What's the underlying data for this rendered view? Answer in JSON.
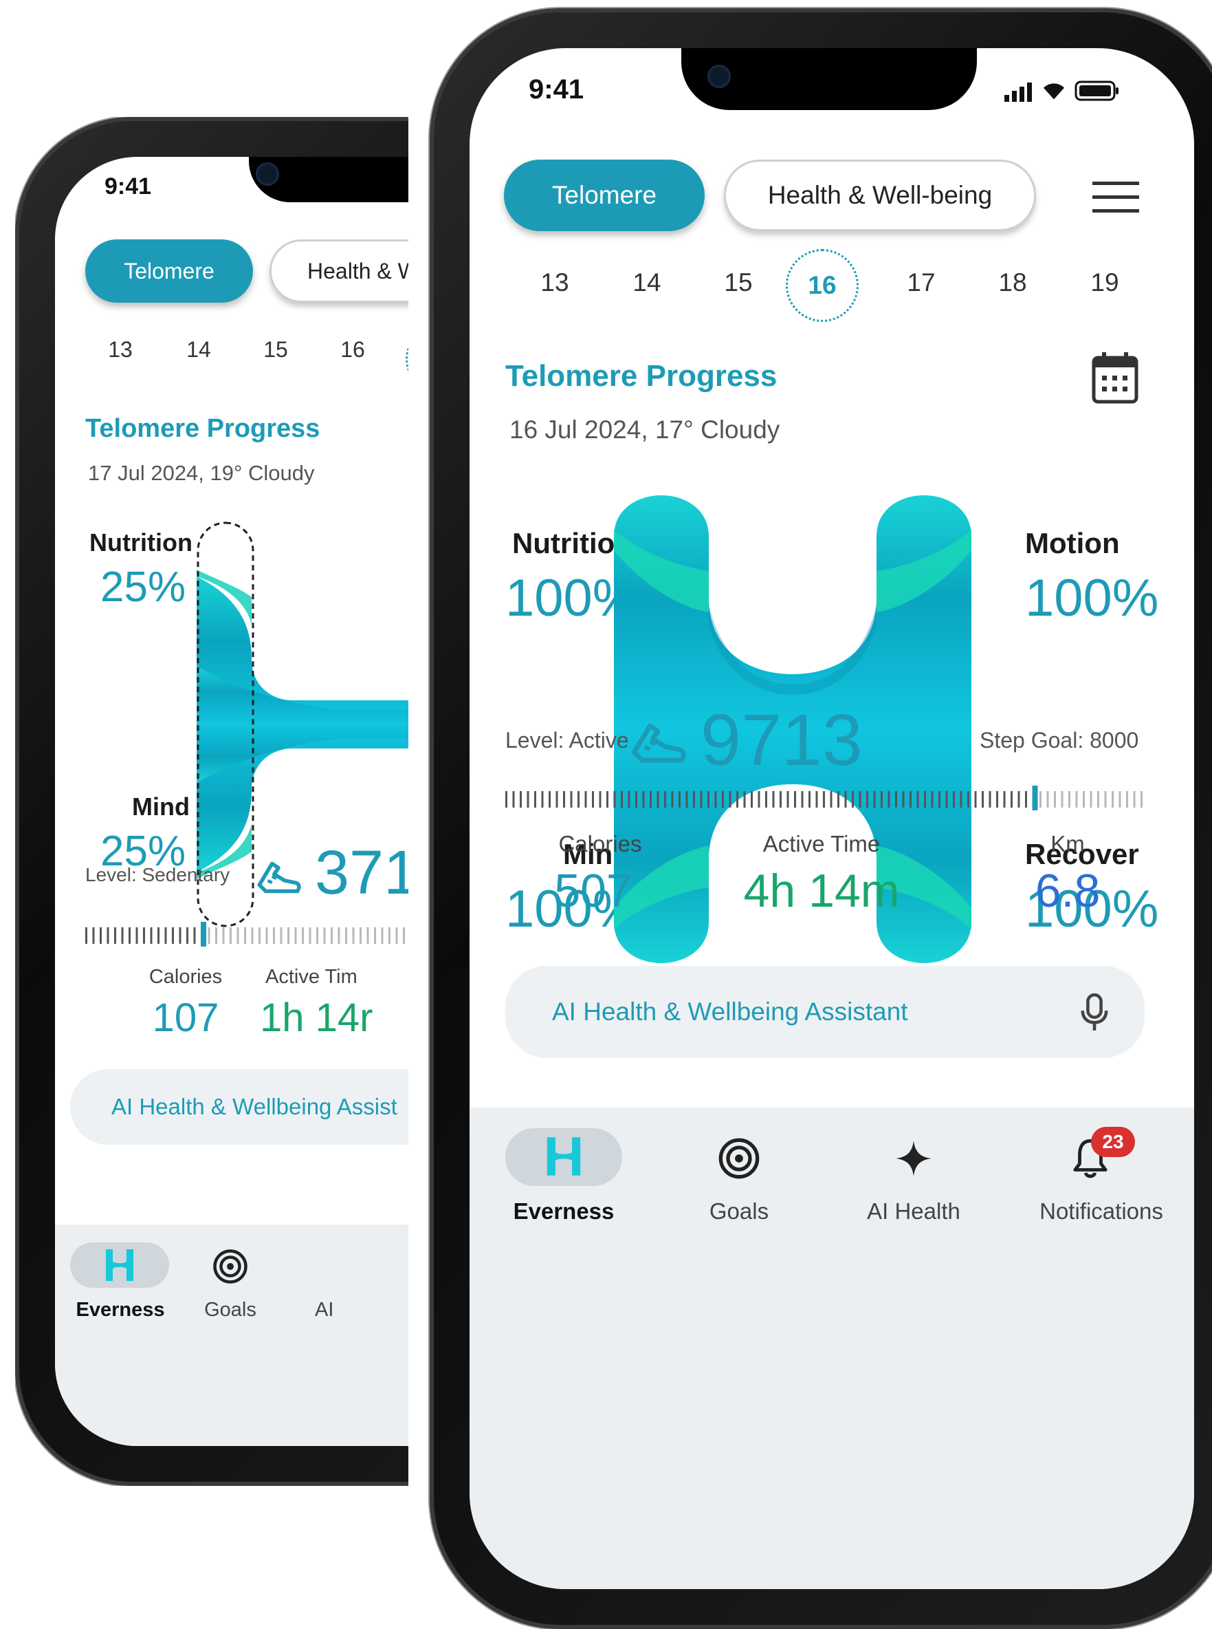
{
  "back_phone": {
    "status_time": "9:41",
    "tabs": [
      "Telomere",
      "Health & W"
    ],
    "dates": [
      "13",
      "14",
      "15",
      "16"
    ],
    "section_title": "Telomere Progress",
    "section_subtitle": "17 Jul 2024, 19° Cloudy",
    "nutrition": {
      "label": "Nutrition",
      "value": "25%"
    },
    "mind": {
      "label": "Mind",
      "value": "25%"
    },
    "level": "Level: Sedentary",
    "steps": "371",
    "step_progress": 0.36,
    "calories": {
      "label": "Calories",
      "value": "107"
    },
    "active_time": {
      "label": "Active Tim",
      "value": "1h 14r"
    },
    "assistant_label": "AI Health & Wellbeing Assist",
    "nav": [
      "Everness",
      "Goals",
      "AI"
    ]
  },
  "front_phone": {
    "status_time": "9:41",
    "tabs": {
      "telomere": "Telomere",
      "health": "Health & Well-being"
    },
    "dates": [
      "13",
      "14",
      "15",
      "16",
      "17",
      "18",
      "19"
    ],
    "selected_date": "16",
    "section_title": "Telomere Progress",
    "section_subtitle": "16 Jul 2024, 17° Cloudy",
    "nutrition": {
      "label": "Nutrition",
      "value": "100%"
    },
    "motion": {
      "label": "Motion",
      "value": "100%"
    },
    "mind": {
      "label": "Mind",
      "value": "100%"
    },
    "recover": {
      "label": "Recover",
      "value": "100%"
    },
    "level": "Level: Active",
    "steps": "9713",
    "step_goal": "Step Goal: 8000",
    "step_progress": 0.83,
    "calories": {
      "label": "Calories",
      "value": "507"
    },
    "active_time": {
      "label": "Active Time",
      "value": "4h 14m"
    },
    "km": {
      "label": "Km",
      "value": "6.8"
    },
    "assistant_label": "AI Health & Wellbeing Assistant",
    "nav": {
      "everness": "Everness",
      "goals": "Goals",
      "ai_health": "AI Health",
      "notifications": "Notifications"
    },
    "notification_count": "23"
  },
  "colors": {
    "accent": "#1d9bb6",
    "green": "#1aa56a",
    "blue": "#2a6fd6",
    "badge": "#d93030"
  },
  "icons": [
    "signal-icon",
    "wifi-icon",
    "battery-icon",
    "menu-icon",
    "calendar-icon",
    "shoe-icon",
    "mic-icon",
    "everness-logo-icon",
    "goals-target-icon",
    "ai-sparkle-icon",
    "bell-icon"
  ]
}
